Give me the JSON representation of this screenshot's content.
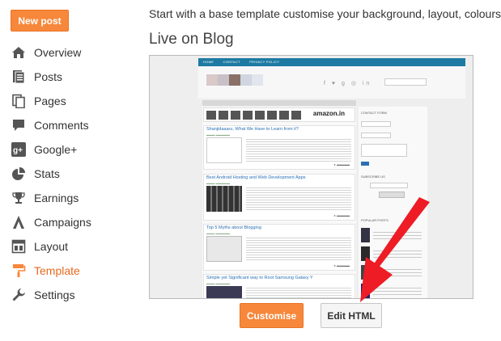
{
  "new_post_label": "New post",
  "sidebar": {
    "items": [
      {
        "label": "Overview",
        "icon": "house-icon"
      },
      {
        "label": "Posts",
        "icon": "posts-icon"
      },
      {
        "label": "Pages",
        "icon": "pages-icon"
      },
      {
        "label": "Comments",
        "icon": "comment-icon"
      },
      {
        "label": "Google+",
        "icon": "googleplus-icon"
      },
      {
        "label": "Stats",
        "icon": "pie-chart-icon"
      },
      {
        "label": "Earnings",
        "icon": "trophy-icon"
      },
      {
        "label": "Campaigns",
        "icon": "campaign-icon"
      },
      {
        "label": "Layout",
        "icon": "layout-icon"
      },
      {
        "label": "Template",
        "icon": "paint-roller-icon",
        "active": true
      },
      {
        "label": "Settings",
        "icon": "wrench-icon"
      }
    ]
  },
  "main": {
    "intro": "Start with a base template customise your background, layout, colours,",
    "heading": "Live on Blog"
  },
  "preview": {
    "menu": [
      "HOME",
      "CONTACT",
      "PRIVACY POLICY"
    ],
    "banner_ad": "amazon.in",
    "posts": [
      {
        "title": "Shanjidaaaru, What We Have to Learn from it?"
      },
      {
        "title": "Best Android Hosting and Web Development Apps"
      },
      {
        "title": "Top 5 Myths about Blogging"
      },
      {
        "title": "Simple yet Significant way to Root Samsung Galaxy Y"
      }
    ],
    "sidebar_titles": [
      "CONTACT FORM",
      "SUBSCRIBE US",
      "POPULAR POSTS"
    ]
  },
  "buttons": {
    "customise": "Customise",
    "edit_html": "Edit HTML"
  },
  "colors": {
    "accent": "#f7873a",
    "active_text": "#e66a1f",
    "annotation_arrow": "#ee1c25"
  }
}
